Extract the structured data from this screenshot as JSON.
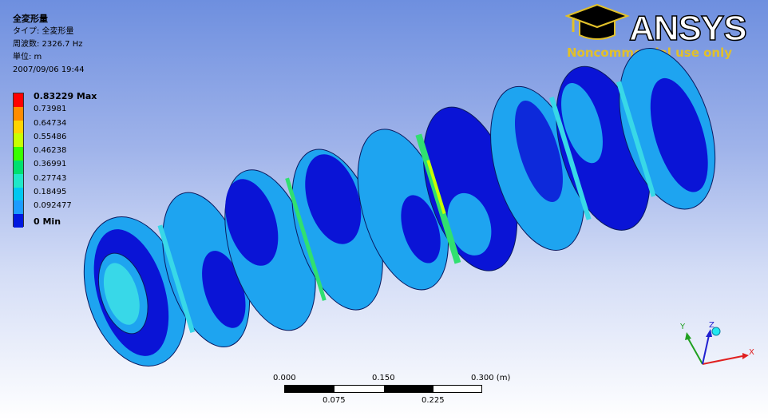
{
  "result_info": {
    "title": "全変形量",
    "type_line": "タイプ: 全変形量",
    "frequency_line": "周波数: 2326.7 Hz",
    "unit_line": "単位: m",
    "datetime_line": "2007/09/06 19:44"
  },
  "legend": {
    "labels": [
      "0.83229 Max",
      "0.73981",
      "0.64734",
      "0.55486",
      "0.46238",
      "0.36991",
      "0.27743",
      "0.18495",
      "0.092477",
      "0 Min"
    ],
    "colors": [
      "#ff0000",
      "#ff8c00",
      "#ffd400",
      "#c8ff00",
      "#38ff00",
      "#00e070",
      "#20e8c8",
      "#00c8f0",
      "#1c9cff",
      "#0018e0"
    ]
  },
  "logo": {
    "brand": "ANSYS",
    "subtitle": "Noncommercial use only",
    "icon": "mortarboard-icon"
  },
  "scale_bar": {
    "top_labels": [
      "0.000",
      "0.150",
      "0.300 (m)"
    ],
    "bottom_labels": [
      "0.075",
      "0.225"
    ]
  },
  "triad": {
    "x_label": "X",
    "y_label": "Y",
    "z_label": "Z",
    "x_color": "#e02020",
    "y_color": "#20a020",
    "z_color": "#2020d0"
  },
  "model": {
    "description_icon": "bellows-mode-shape",
    "dark_blue": "#0a14d6",
    "light_blue": "#1ea4f0",
    "cyan": "#38d8e8",
    "green": "#30e070"
  }
}
